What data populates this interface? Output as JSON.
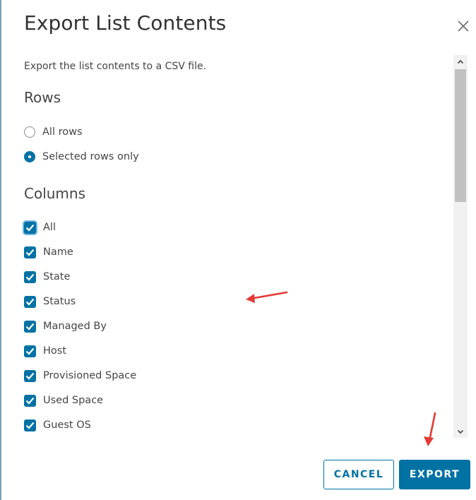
{
  "dialog": {
    "title": "Export List Contents",
    "close_icon": "close-icon",
    "description": "Export the list contents to a CSV file."
  },
  "rows": {
    "heading": "Rows",
    "options": [
      {
        "label": "All rows",
        "selected": false
      },
      {
        "label": "Selected rows only",
        "selected": true
      }
    ]
  },
  "columns": {
    "heading": "Columns",
    "items": [
      {
        "label": "All",
        "checked": true
      },
      {
        "label": "Name",
        "checked": true
      },
      {
        "label": "State",
        "checked": true
      },
      {
        "label": "Status",
        "checked": true
      },
      {
        "label": "Managed By",
        "checked": true
      },
      {
        "label": "Host",
        "checked": true
      },
      {
        "label": "Provisioned Space",
        "checked": true
      },
      {
        "label": "Used Space",
        "checked": true
      },
      {
        "label": "Guest OS",
        "checked": true
      }
    ]
  },
  "scrollbar": {
    "up_icon": "chevron-up-icon",
    "down_icon": "chevron-down-icon"
  },
  "buttons": {
    "cancel_label": "CANCEL",
    "export_label": "EXPORT"
  },
  "annotations": {
    "arrow_icon": "red-arrow-icon"
  },
  "colors": {
    "accent": "#0072a3",
    "annotation": "#e53935"
  }
}
